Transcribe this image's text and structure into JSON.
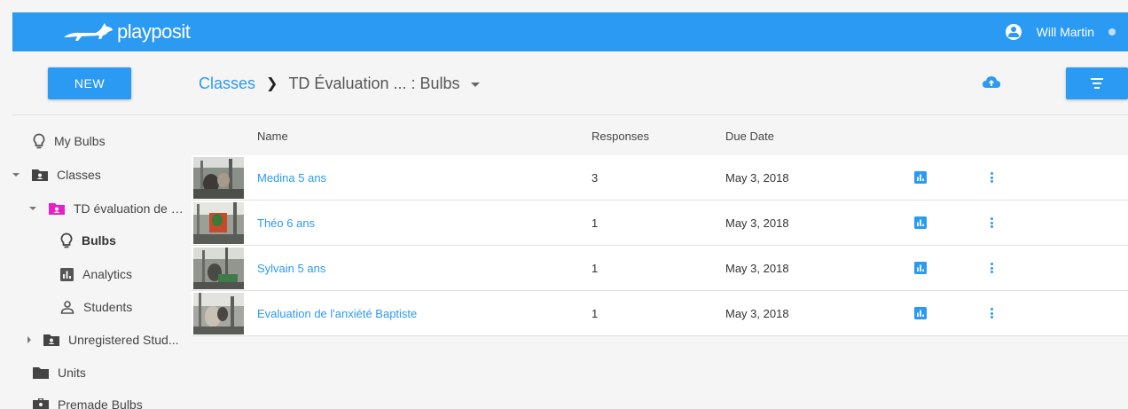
{
  "app": {
    "logo_text": "playposit",
    "brand_color": "#2b9af3"
  },
  "header": {
    "user_name": "Will Martin",
    "user_icon": "account-circle-icon"
  },
  "toolbar": {
    "new_label": "NEW",
    "upload_icon": "cloud-upload-icon",
    "filter_icon": "filter-icon"
  },
  "breadcrumb": {
    "root": "Classes",
    "current": "TD Évaluation ... : Bulbs"
  },
  "sidebar": {
    "items": [
      {
        "label": "My Bulbs",
        "icon": "lightbulb-icon"
      },
      {
        "label": "Classes",
        "icon": "class-folder-icon"
      },
      {
        "label": "TD évaluation de l'...",
        "icon": "class-folder-icon"
      },
      {
        "label": "Bulbs",
        "icon": "lightbulb-icon"
      },
      {
        "label": "Analytics",
        "icon": "analytics-icon"
      },
      {
        "label": "Students",
        "icon": "person-icon"
      },
      {
        "label": "Unregistered Stud...",
        "icon": "class-folder-icon"
      },
      {
        "label": "Units",
        "icon": "folder-icon"
      },
      {
        "label": "Premade Bulbs",
        "icon": "briefcase-icon"
      }
    ]
  },
  "table": {
    "columns": {
      "name": "Name",
      "responses": "Responses",
      "due": "Due Date"
    },
    "rows": [
      {
        "name": "Medina 5 ans",
        "responses": "3",
        "due": "May 3, 2018"
      },
      {
        "name": "Théo 6 ans",
        "responses": "1",
        "due": "May 3, 2018"
      },
      {
        "name": "Sylvain 5 ans",
        "responses": "1",
        "due": "May 3, 2018"
      },
      {
        "name": "Evaluation de l'anxiété Baptiste",
        "responses": "1",
        "due": "May 3, 2018"
      }
    ]
  }
}
